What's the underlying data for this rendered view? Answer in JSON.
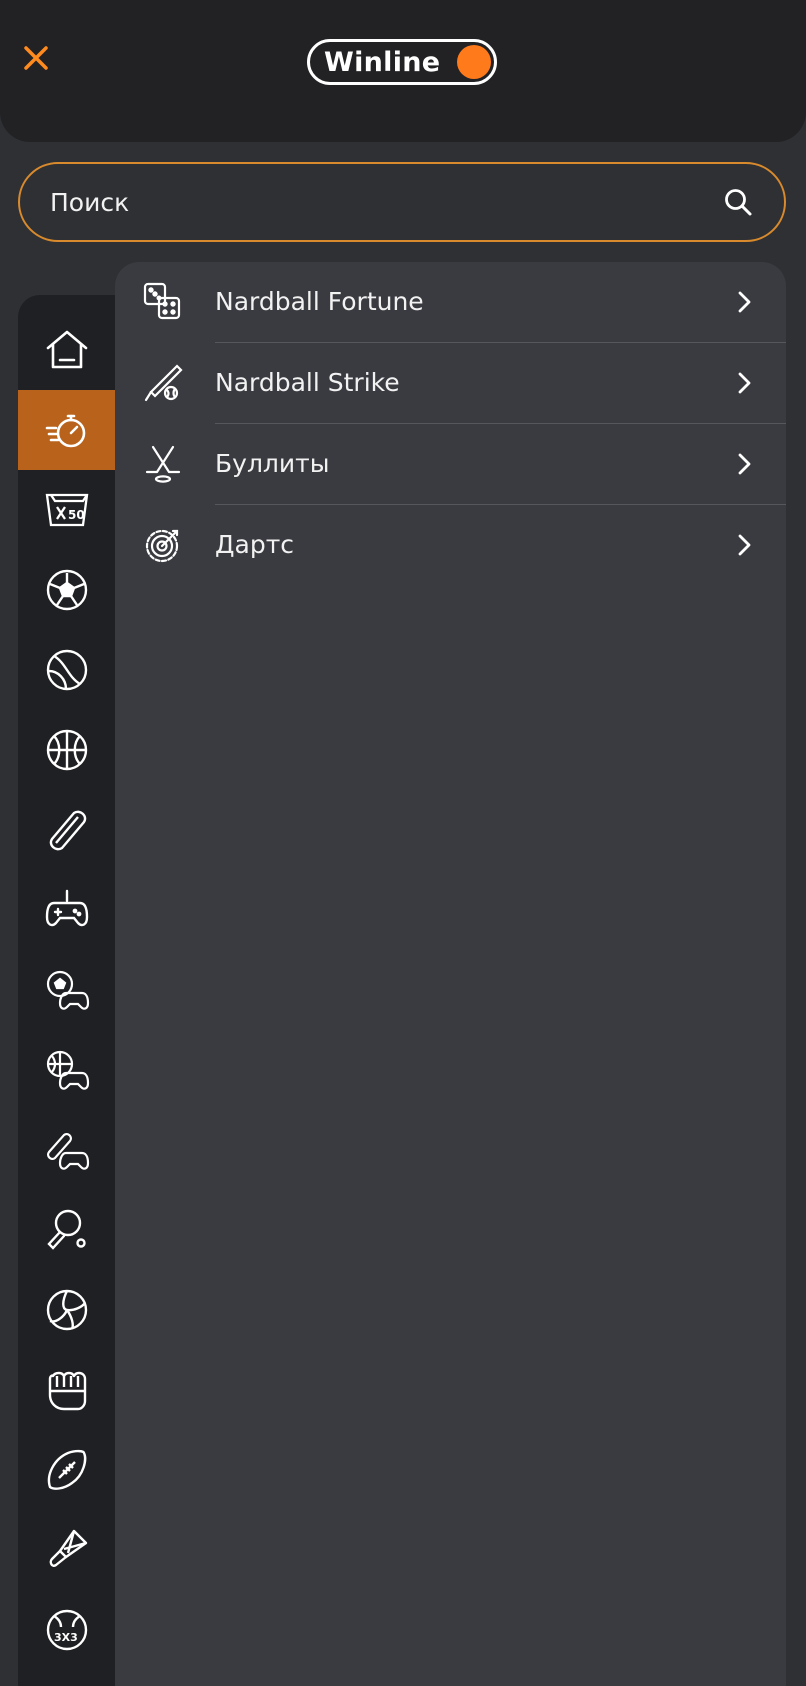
{
  "header": {
    "logo_text": "Winline",
    "close_icon": "close-icon"
  },
  "search": {
    "placeholder": "Поиск",
    "value": "",
    "icon": "search-icon"
  },
  "sidebar": {
    "active_index": 1,
    "items": [
      {
        "icon": "home-icon"
      },
      {
        "icon": "stopwatch-icon"
      },
      {
        "icon": "x50-icon"
      },
      {
        "icon": "soccer-ball-icon"
      },
      {
        "icon": "tennis-ball-icon"
      },
      {
        "icon": "basketball-icon"
      },
      {
        "icon": "hockey-puck-icon"
      },
      {
        "icon": "gamepad-icon"
      },
      {
        "icon": "esports-soccer-icon"
      },
      {
        "icon": "esports-basketball-icon"
      },
      {
        "icon": "esports-hockey-icon"
      },
      {
        "icon": "table-tennis-icon"
      },
      {
        "icon": "volleyball-icon"
      },
      {
        "icon": "boxing-glove-icon"
      },
      {
        "icon": "american-football-icon"
      },
      {
        "icon": "badminton-icon"
      },
      {
        "icon": "basketball-3x3-icon"
      }
    ]
  },
  "menu": {
    "items": [
      {
        "label": "Nardball Fortune",
        "icon": "dice-icon"
      },
      {
        "label": "Nardball Strike",
        "icon": "bat-ball-icon"
      },
      {
        "label": "Буллиты",
        "icon": "hockey-sticks-icon"
      },
      {
        "label": "Дартс",
        "icon": "dartboard-icon"
      }
    ]
  },
  "colors": {
    "accent": "#ff7a1a",
    "active_rail": "#b8621b",
    "search_border": "#d88a2c",
    "background": "#2f3034",
    "panel": "#3a3b40",
    "header": "#222224"
  }
}
